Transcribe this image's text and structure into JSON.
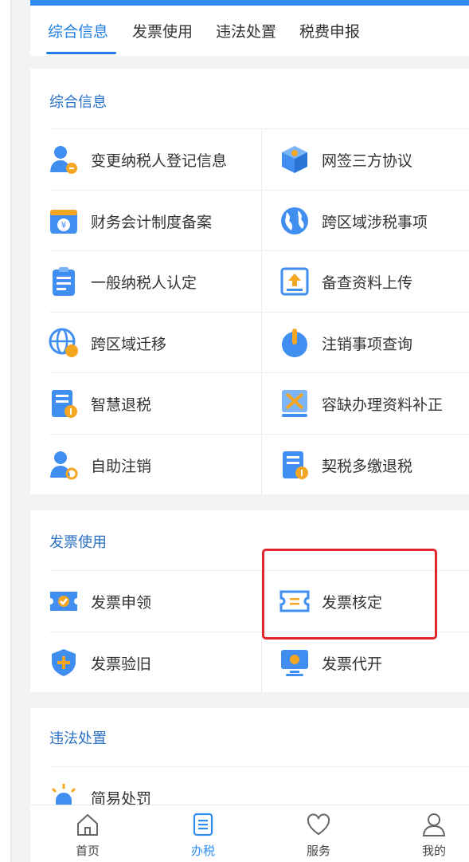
{
  "tabs": [
    {
      "label": "综合信息",
      "active": true
    },
    {
      "label": "发票使用",
      "active": false
    },
    {
      "label": "违法处置",
      "active": false
    },
    {
      "label": "税费申报",
      "active": false
    }
  ],
  "sections": {
    "comprehensive": {
      "title": "综合信息",
      "items": [
        {
          "label": "变更纳税人登记信息",
          "icon": "user-edit-icon"
        },
        {
          "label": "网签三方协议",
          "icon": "agreement-box-icon"
        },
        {
          "label": "财务会计制度备案",
          "icon": "finance-wallet-icon"
        },
        {
          "label": "跨区域涉税事项",
          "icon": "globe-icon"
        },
        {
          "label": "一般纳税人认定",
          "icon": "clipboard-list-icon"
        },
        {
          "label": "备查资料上传",
          "icon": "upload-icon"
        },
        {
          "label": "跨区域迁移",
          "icon": "globe-handshake-icon"
        },
        {
          "label": "注销事项查询",
          "icon": "power-icon"
        },
        {
          "label": "智慧退税",
          "icon": "refund-document-icon"
        },
        {
          "label": "容缺办理资料补正",
          "icon": "correction-icon"
        },
        {
          "label": "自助注销",
          "icon": "user-settings-icon"
        },
        {
          "label": "契税多缴退税",
          "icon": "tax-refund-document-icon"
        }
      ]
    },
    "invoice": {
      "title": "发票使用",
      "items": [
        {
          "label": "发票申领",
          "icon": "invoice-apply-icon"
        },
        {
          "label": "发票核定",
          "icon": "invoice-ticket-icon"
        },
        {
          "label": "发票验旧",
          "icon": "shield-plus-icon"
        },
        {
          "label": "发票代开",
          "icon": "invoice-monitor-icon"
        }
      ]
    },
    "violation": {
      "title": "违法处置",
      "items": [
        {
          "label": "简易处罚",
          "icon": "alarm-light-icon"
        }
      ]
    }
  },
  "bottom_nav": [
    {
      "label": "首页",
      "icon": "home-icon",
      "active": false
    },
    {
      "label": "办税",
      "icon": "tax-list-icon",
      "active": true
    },
    {
      "label": "服务",
      "icon": "heart-icon",
      "active": false
    },
    {
      "label": "我的",
      "icon": "user-icon",
      "active": false
    }
  ],
  "colors": {
    "accent": "#1f7fe8",
    "highlight": "#e0262b",
    "section_title": "#2a6fc6"
  }
}
